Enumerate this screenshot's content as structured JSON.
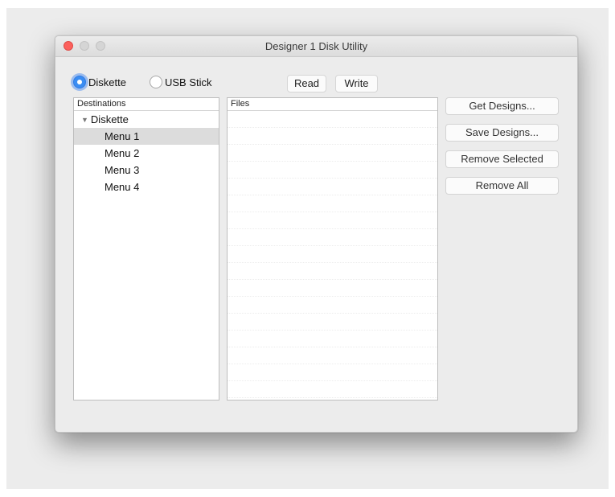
{
  "window": {
    "title": "Designer 1 Disk Utility"
  },
  "media": {
    "options": [
      {
        "label": "Diskette",
        "selected": true
      },
      {
        "label": "USB Stick",
        "selected": false
      }
    ]
  },
  "toolbar": {
    "read_label": "Read",
    "write_label": "Write"
  },
  "destinations": {
    "header": "Destinations",
    "root": "Diskette",
    "items": [
      "Menu 1",
      "Menu 2",
      "Menu 3",
      "Menu 4"
    ],
    "selected_item": "Menu 1"
  },
  "files": {
    "header": "Files",
    "rows": []
  },
  "actions": {
    "get_designs": "Get Designs...",
    "save_designs": "Save Designs...",
    "remove_selected": "Remove Selected",
    "remove_all": "Remove All"
  },
  "colors": {
    "accent": "#3b8df2",
    "close_light": "#fc605c",
    "selection": "#dcdcdc"
  },
  "icons": {
    "tree_toggle": "disclosure-triangle-down-icon"
  }
}
